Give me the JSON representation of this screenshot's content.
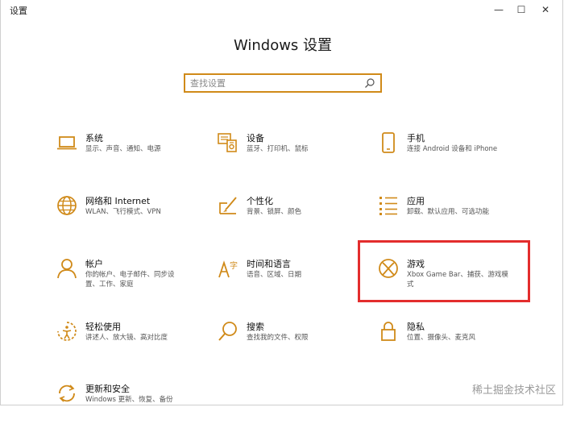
{
  "window": {
    "title": "设置",
    "minimize": "—",
    "maximize": "☐",
    "close": "✕"
  },
  "heading": "Windows 设置",
  "search": {
    "placeholder": "查找设置",
    "value": ""
  },
  "tiles": [
    {
      "name": "系统",
      "desc": "显示、声音、通知、电源",
      "icon": "laptop-icon"
    },
    {
      "name": "设备",
      "desc": "蓝牙、打印机、鼠标",
      "icon": "devices-icon"
    },
    {
      "name": "手机",
      "desc": "连接 Android 设备和 iPhone",
      "icon": "phone-icon"
    },
    {
      "name": "网络和 Internet",
      "desc": "WLAN、飞行模式、VPN",
      "icon": "globe-icon"
    },
    {
      "name": "个性化",
      "desc": "背景、锁屏、颜色",
      "icon": "paintbrush-icon"
    },
    {
      "name": "应用",
      "desc": "卸载、默认应用、可选功能",
      "icon": "apps-list-icon"
    },
    {
      "name": "帐户",
      "desc": "你的帐户、电子邮件、同步设置、工作、家庭",
      "icon": "person-icon"
    },
    {
      "name": "时间和语言",
      "desc": "语音、区域、日期",
      "icon": "time-language-icon"
    },
    {
      "name": "游戏",
      "desc": "Xbox Game Bar、捕获、游戏模式",
      "icon": "xbox-icon"
    },
    {
      "name": "轻松使用",
      "desc": "讲述人、放大镜、高对比度",
      "icon": "ease-of-access-icon"
    },
    {
      "name": "搜索",
      "desc": "查找我的文件、权限",
      "icon": "magnifier-icon"
    },
    {
      "name": "隐私",
      "desc": "位置、摄像头、麦克风",
      "icon": "lock-icon"
    },
    {
      "name": "更新和安全",
      "desc": "Windows 更新、恢复、备份",
      "icon": "sync-icon"
    }
  ],
  "watermark": "稀土掘金技术社区",
  "colors": {
    "accent": "#d08a19",
    "highlight": "#e32d2d"
  }
}
